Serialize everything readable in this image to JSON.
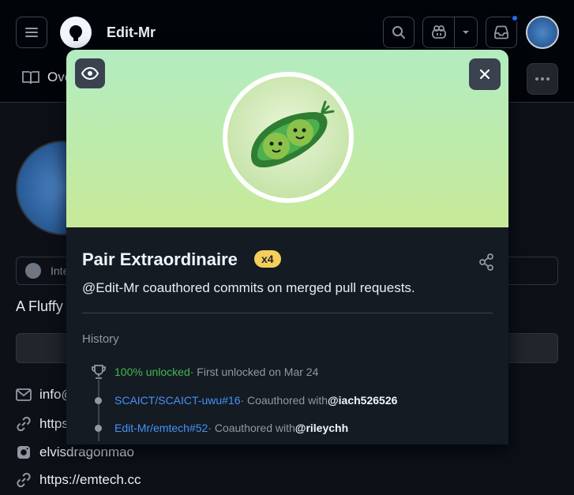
{
  "header": {
    "user": "Edit-Mr",
    "tab_label": "Overview"
  },
  "profile": {
    "status_text": "Interested in...",
    "bio": "A Fluffy ...",
    "contacts": {
      "email": "info@...",
      "website": "https://...",
      "instagram": "elvisdragonmao",
      "link2": "https://emtech.cc"
    }
  },
  "modal": {
    "title": "Pair Extraordinaire",
    "count": "x4",
    "description": "@Edit-Mr coauthored commits on merged pull requests.",
    "history_label": "History",
    "history": [
      {
        "icon": "trophy-icon",
        "highlight": "100% unlocked",
        "text": " · First unlocked on Mar 24"
      },
      {
        "icon": "dot",
        "link": "SCAICT/SCAICT-uwu#16",
        "text": " · Coauthored with ",
        "user": "@iach526526"
      },
      {
        "icon": "dot",
        "link": "Edit-Mr/emtech#52",
        "text": " · Coauthored with ",
        "user": "@rileychh"
      }
    ]
  },
  "colors": {
    "background": "#0d1117",
    "modal": "#151b23",
    "accent_green": "#3fb950",
    "link_blue": "#4493f8",
    "badge_yellow": "#f5cf5a",
    "notification": "#1f6feb"
  },
  "icons": [
    "hamburger-icon",
    "github-logo-icon",
    "search-icon",
    "copilot-icon",
    "chevron-down-icon",
    "inbox-icon",
    "book-icon",
    "kebab-icon",
    "eye-icon",
    "close-icon",
    "share-icon",
    "trophy-icon",
    "mail-icon",
    "link-icon",
    "instagram-icon"
  ]
}
